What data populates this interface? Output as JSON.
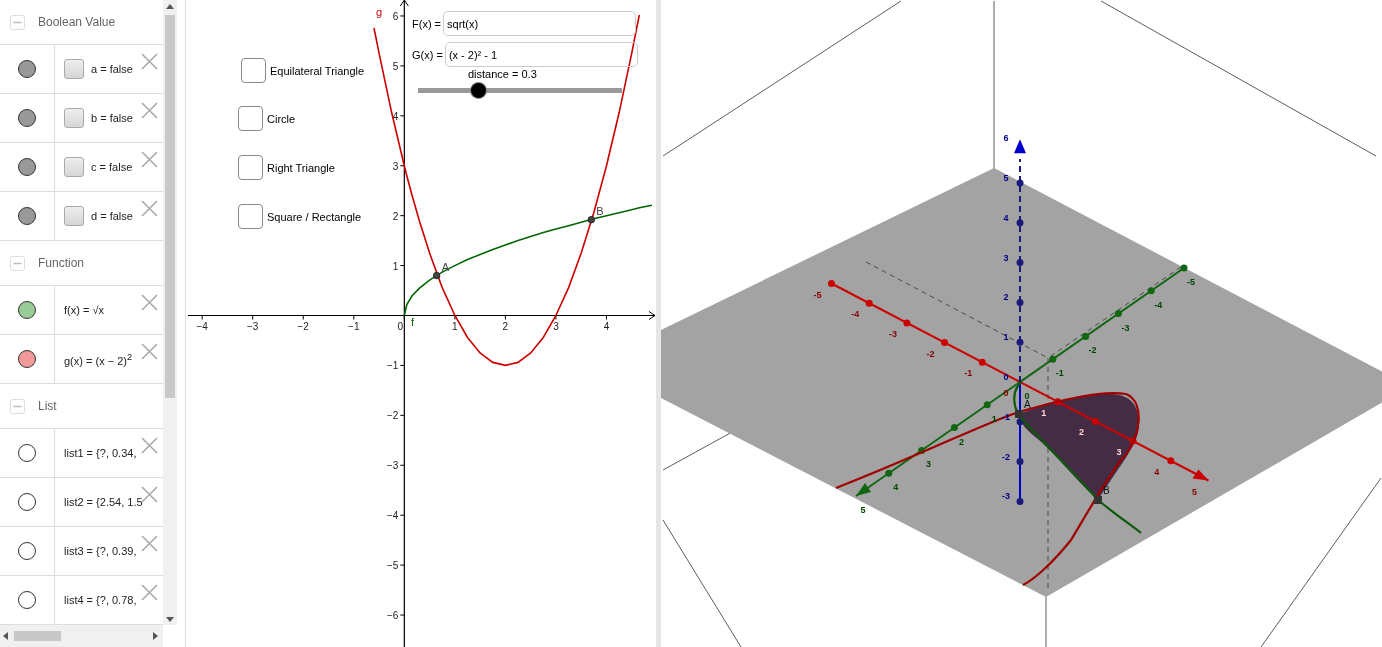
{
  "algebra_view": {
    "groups": [
      {
        "title": "Boolean Value",
        "expanded": true,
        "items": [
          {
            "kind": "boolean",
            "text": "a = false",
            "visible": true,
            "color": "#999999",
            "checked": false
          },
          {
            "kind": "boolean",
            "text": "b = false",
            "visible": true,
            "color": "#999999",
            "checked": false
          },
          {
            "kind": "boolean",
            "text": "c = false",
            "visible": true,
            "color": "#999999",
            "checked": false
          },
          {
            "kind": "boolean",
            "text": "d = false",
            "visible": true,
            "color": "#999999",
            "checked": false
          }
        ]
      },
      {
        "title": "Function",
        "expanded": true,
        "items": [
          {
            "kind": "function",
            "text": "f(x) = √x",
            "visible": true,
            "color": "#99cc99"
          },
          {
            "kind": "function",
            "text": "g(x) = (x − 2)$^{2}$",
            "visible": true,
            "color": "#f29a9a"
          }
        ]
      },
      {
        "title": "List",
        "expanded": true,
        "items": [
          {
            "kind": "list",
            "text": "list1 = {?, 0.34,",
            "visible": false
          },
          {
            "kind": "list",
            "text": "list2 = {2.54, 1.5",
            "visible": false
          },
          {
            "kind": "list",
            "text": "list3 = {?, 0.39,",
            "visible": false
          },
          {
            "kind": "list",
            "text": "list4 = {?, 0.78,",
            "visible": false
          }
        ]
      }
    ]
  },
  "graphics_2d": {
    "checkboxes": [
      {
        "label": "Equilateral Triangle",
        "checked": false
      },
      {
        "label": "Circle",
        "checked": false
      },
      {
        "label": "Right Triangle",
        "checked": false
      },
      {
        "label": "Square / Rectangle",
        "checked": false
      }
    ],
    "inputs": [
      {
        "label": "F(x) =",
        "value": "sqrt(x)"
      },
      {
        "label": "G(x) =",
        "value": "(x - 2)² - 1"
      }
    ],
    "slider": {
      "label": "distance = 0.3",
      "level": 0.3
    },
    "chart_data": {
      "type": "line",
      "xlim": [
        -4.32,
        4.98
      ],
      "ylim": [
        -6.64,
        6.32
      ],
      "xticks": [
        {
          "value": -4,
          "label": "−4"
        },
        {
          "value": -3,
          "label": "−3"
        },
        {
          "value": -2,
          "label": "−2"
        },
        {
          "value": -1,
          "label": "−1"
        },
        {
          "value": 0,
          "label": "0"
        },
        {
          "value": 1,
          "label": "1"
        },
        {
          "value": 2,
          "label": "2"
        },
        {
          "value": 3,
          "label": "3"
        },
        {
          "value": 4,
          "label": "4"
        }
      ],
      "yticks": [
        {
          "value": 6,
          "label": "6"
        },
        {
          "value": 5,
          "label": "5"
        },
        {
          "value": 4,
          "label": "4"
        },
        {
          "value": 3,
          "label": "3"
        },
        {
          "value": 2,
          "label": "2"
        },
        {
          "value": 1,
          "label": "1"
        },
        {
          "value": -1,
          "label": "−1"
        },
        {
          "value": -2,
          "label": "−2"
        },
        {
          "value": -3,
          "label": "−3"
        },
        {
          "value": -4,
          "label": "−4"
        },
        {
          "value": -5,
          "label": "−5"
        },
        {
          "value": -6,
          "label": "−6"
        }
      ],
      "x": [
        -0.6,
        -0.5,
        -0.25,
        0,
        0.05,
        0.15,
        0.3,
        0.5,
        0.75,
        1,
        1.25,
        1.5,
        1.75,
        2,
        2.25,
        2.5,
        2.75,
        3,
        3.25,
        3.5,
        3.75,
        4,
        4.25,
        4.5,
        4.65,
        4.9
      ],
      "series": [
        {
          "name": "g",
          "color": "#cc0000",
          "values": [
            5.76,
            5.25,
            4.06,
            3,
            2.8,
            2.42,
            1.89,
            1.25,
            0.56,
            0,
            -0.44,
            -0.75,
            -0.94,
            -1,
            -0.94,
            -0.75,
            -0.44,
            0,
            0.56,
            1.25,
            2.06,
            3,
            4.06,
            5.25,
            6.02,
            null
          ]
        },
        {
          "name": "f",
          "color": "#006600",
          "values": [
            null,
            null,
            null,
            0,
            0.22,
            0.39,
            0.55,
            0.71,
            0.87,
            1,
            1.12,
            1.22,
            1.32,
            1.41,
            1.5,
            1.58,
            1.66,
            1.73,
            1.8,
            1.87,
            1.94,
            2,
            2.06,
            2.12,
            2.16,
            2.21
          ]
        }
      ],
      "annotations": [
        "A",
        "B"
      ]
    }
  },
  "graphics_3d": {
    "x_axis_labels": [
      "-5",
      "-4",
      "-3",
      "-2",
      "-1",
      "0",
      "1",
      "2",
      "3",
      "4",
      "5"
    ],
    "y_axis_labels": [
      "-5",
      "-4",
      "-3",
      "-2",
      "-1",
      "0",
      "1",
      "2",
      "3",
      "4",
      "5"
    ],
    "z_axis_labels": [
      "6",
      "5",
      "4",
      "3",
      "2",
      "1",
      "0",
      "-1",
      "-2",
      "-3"
    ],
    "points": [
      "A",
      "B"
    ]
  }
}
